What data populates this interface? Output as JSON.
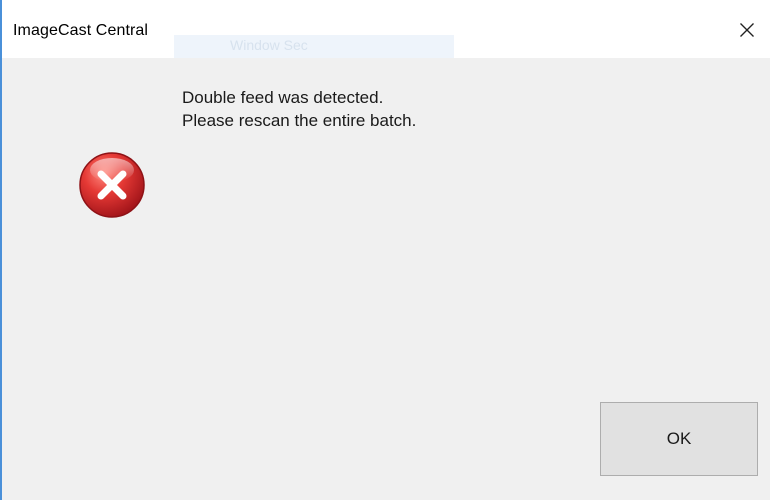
{
  "window": {
    "title": "ImageCast Central",
    "background_title_text": "Window Sec",
    "accent_color": "#4a90d9"
  },
  "dialog": {
    "icon": "error-icon",
    "icon_color": "#d9262b",
    "message_lines": [
      "Double feed was detected.",
      "Please rescan the entire batch."
    ],
    "ok_label": "OK"
  },
  "controls": {
    "close_icon": "close-icon"
  }
}
